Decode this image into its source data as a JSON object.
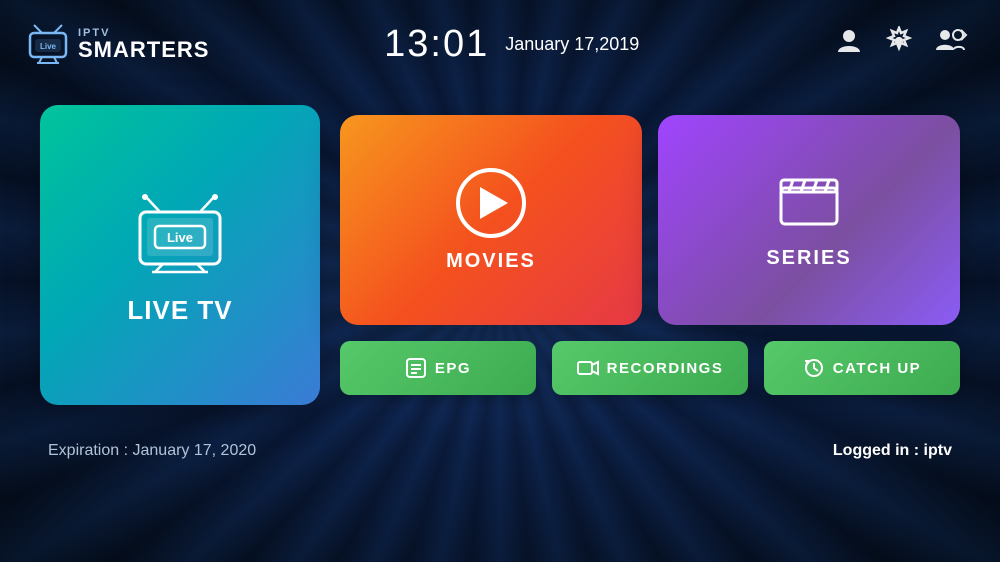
{
  "app": {
    "name": "IPTV SMARTERS",
    "iptv_prefix": "IPTV",
    "smarters_label": "SMARTERS"
  },
  "header": {
    "time": "13:01",
    "date": "January 17,2019",
    "profile_icon": "👤",
    "settings_icon": "⚙",
    "switch_icon": "🔄"
  },
  "cards": {
    "live_tv": {
      "label": "LIVE TV"
    },
    "movies": {
      "label": "MOVIES"
    },
    "series": {
      "label": "SERIES"
    }
  },
  "buttons": {
    "epg": "EPG",
    "recordings": "RECORDINGS",
    "catch_up": "CATCH UP"
  },
  "footer": {
    "expiry_label": "Expiration :",
    "expiry_date": "January 17, 2020",
    "login_label": "Logged in :",
    "login_user": "iptv"
  }
}
